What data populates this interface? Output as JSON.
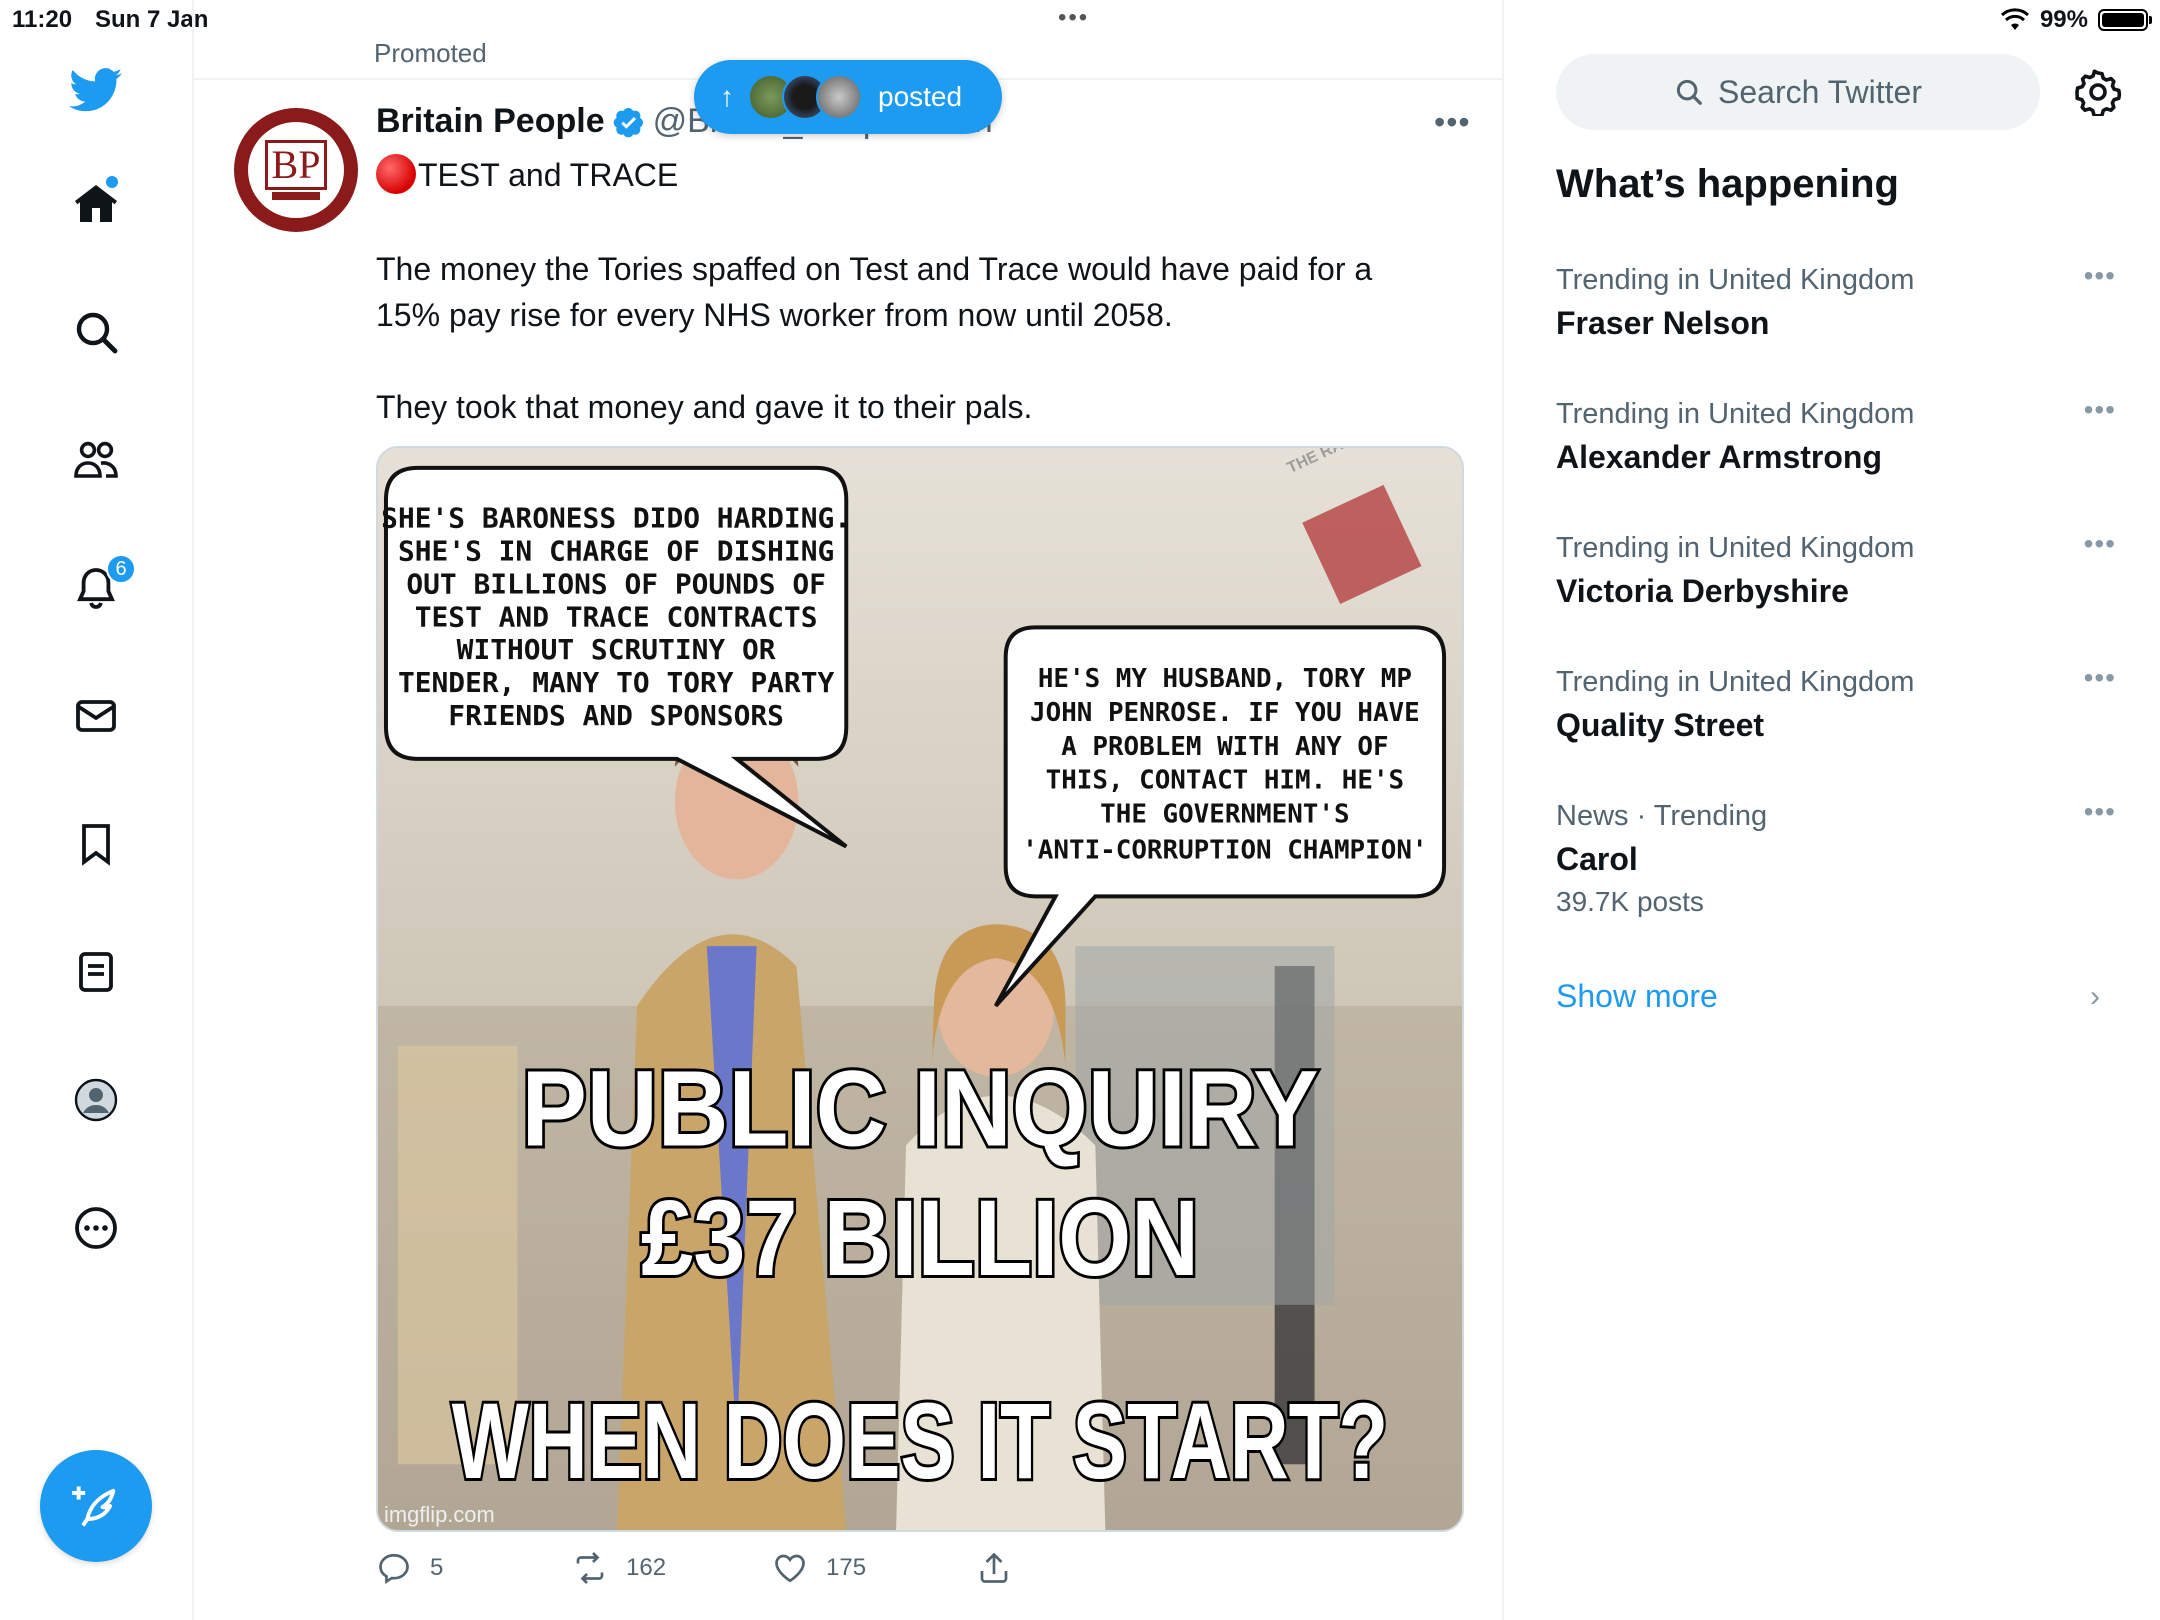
{
  "status_bar": {
    "time": "11:20",
    "date": "Sun 7 Jan",
    "battery": "99%",
    "battery_level": 0.99
  },
  "nav": {
    "notifications_badge": "6",
    "items": [
      "twitter-logo",
      "home",
      "explore",
      "communities",
      "notifications",
      "messages",
      "bookmarks",
      "lists",
      "profile",
      "more"
    ]
  },
  "top_strip": {
    "label": "Promoted"
  },
  "new_posts_pill": {
    "label": "posted"
  },
  "tweet": {
    "author_name": "Britain People",
    "handle": "@Britain_People · 11h",
    "title": "TEST and TRACE",
    "body_line1": "The money the Tories spaffed on Test and Trace would have paid for a",
    "body_line2": "15% pay rise for every NHS worker from now until 2058.",
    "body_line3": "They took that money and gave it to their pals.",
    "image": {
      "bubble_left": [
        "SHE'S BARONESS DIDO HARDING.",
        "SHE'S IN CHARGE OF DISHING",
        "OUT BILLIONS OF POUNDS OF",
        "TEST AND TRACE CONTRACTS",
        "WITHOUT SCRUTINY OR",
        "TENDER, MANY TO TORY PARTY",
        "FRIENDS  AND SPONSORS"
      ],
      "bubble_right": [
        "HE'S MY HUSBAND, TORY MP",
        "JOHN PENROSE. IF YOU HAVE",
        "A PROBLEM WITH ANY OF",
        "THIS, CONTACT HIM. HE'S",
        "THE GOVERNMENT'S",
        "'ANTI-CORRUPTION CHAMPION'"
      ],
      "caption_1": "PUBLIC INQUIRY",
      "caption_2": "£37 BILLION",
      "caption_3": "WHEN DOES IT START?",
      "watermark": "imgflip.com",
      "logo_text": "THE RAGGED TROUSERED PHILANDERER"
    },
    "replies": "5",
    "reposts": "162",
    "likes": "175"
  },
  "sidebar": {
    "search_placeholder": "Search Twitter",
    "section_title": "What’s happening",
    "trends": [
      {
        "meta": "Trending in United Kingdom",
        "name": "Fraser Nelson",
        "count": ""
      },
      {
        "meta": "Trending in United Kingdom",
        "name": "Alexander Armstrong",
        "count": ""
      },
      {
        "meta": "Trending in United Kingdom",
        "name": "Victoria Derbyshire",
        "count": ""
      },
      {
        "meta": "Trending in United Kingdom",
        "name": "Quality Street",
        "count": ""
      },
      {
        "meta": "News · Trending",
        "name": "Carol",
        "count": "39.7K posts"
      }
    ],
    "show_more": "Show more"
  },
  "colors": {
    "accent": "#1d9bf0",
    "text_primary": "#0f1419",
    "text_secondary": "#536471",
    "brand_red": "#8b1a1a"
  }
}
